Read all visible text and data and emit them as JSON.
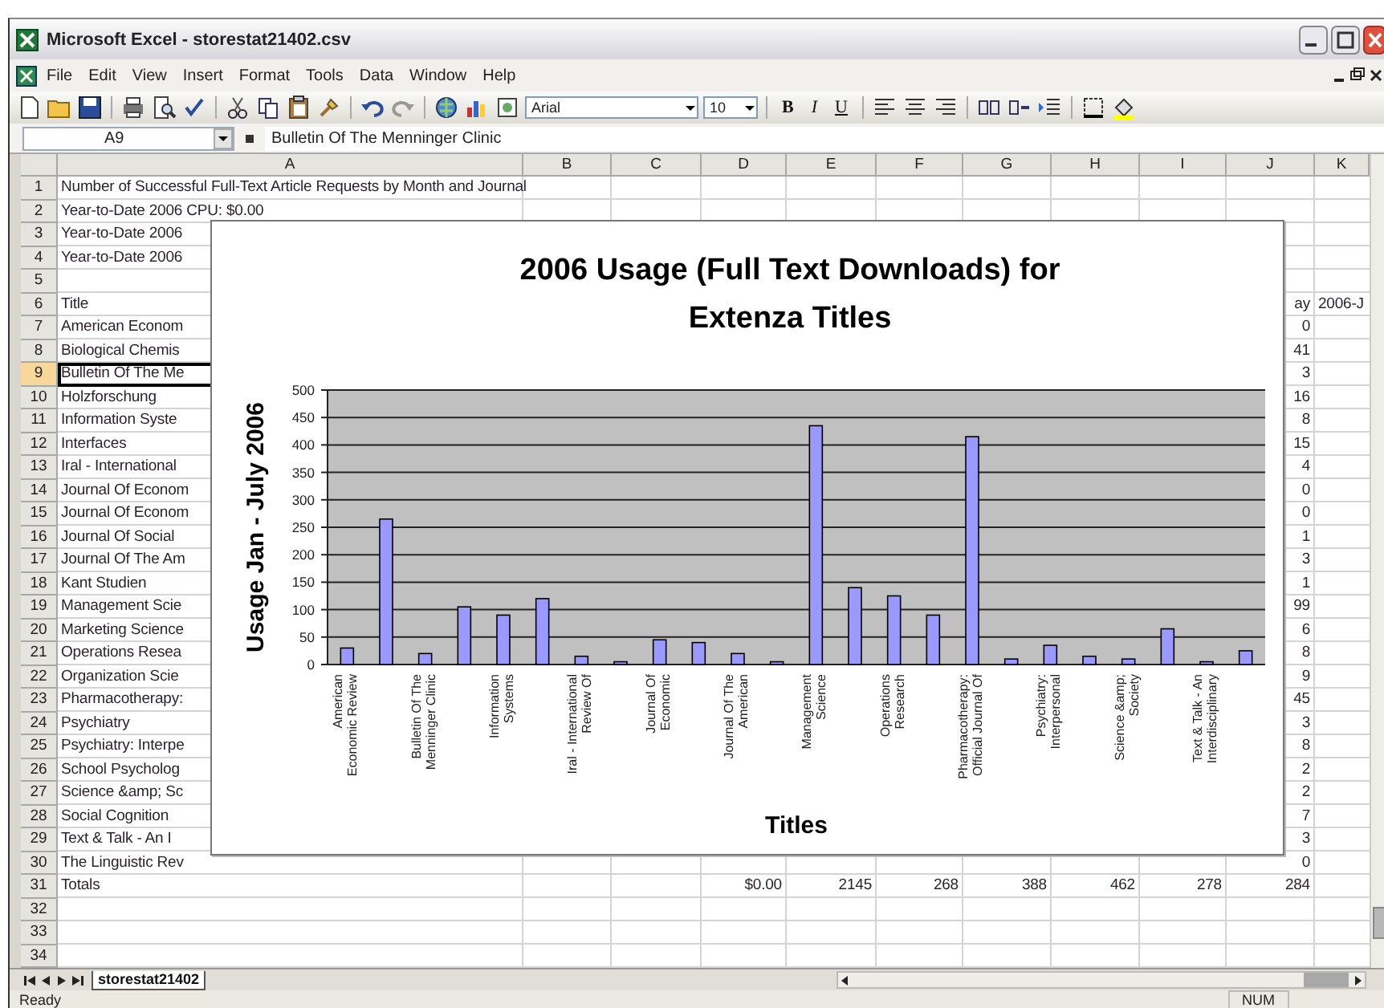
{
  "window": {
    "title": "Microsoft Excel - storestat21402.csv"
  },
  "menu": [
    "File",
    "Edit",
    "View",
    "Insert",
    "Format",
    "Tools",
    "Data",
    "Window",
    "Help"
  ],
  "toolbar": {
    "font": "Arial",
    "size": "10",
    "format_buttons": [
      "B",
      "I",
      "U"
    ]
  },
  "formula_bar": {
    "name_box": "A9",
    "content": "Bulletin Of The Menninger Clinic"
  },
  "columns": [
    "A",
    "B",
    "C",
    "D",
    "E",
    "F",
    "G",
    "H",
    "I",
    "J",
    "K"
  ],
  "rows": [
    {
      "number": "1",
      "selected": false,
      "cells": {
        "A": "Number of Successful Full-Text Article Requests by Month and Journal"
      }
    },
    {
      "number": "2",
      "selected": false,
      "cells": {
        "A": "Year-to-Date 2006 CPU: $0.00"
      }
    },
    {
      "number": "3",
      "selected": false,
      "cells": {
        "A": "Year-to-Date 2006"
      }
    },
    {
      "number": "4",
      "selected": false,
      "cells": {
        "A": "Year-to-Date 2006"
      }
    },
    {
      "number": "5",
      "selected": false
    },
    {
      "number": "6",
      "selected": false,
      "cells": {
        "A": "Title",
        "J": "ay",
        "K": "2006-J"
      }
    },
    {
      "number": "7",
      "selected": false,
      "cells": {
        "A": "American Econom",
        "J": "0"
      }
    },
    {
      "number": "8",
      "selected": false,
      "cells": {
        "A": "Biological Chemis",
        "J": "41"
      }
    },
    {
      "number": "9",
      "selected": true,
      "cells": {
        "A": "Bulletin Of The Me",
        "J": "3"
      }
    },
    {
      "number": "10",
      "selected": false,
      "cells": {
        "A": "Holzforschung",
        "J": "16"
      }
    },
    {
      "number": "11",
      "selected": false,
      "cells": {
        "A": "Information Syste",
        "J": "8"
      }
    },
    {
      "number": "12",
      "selected": false,
      "cells": {
        "A": "Interfaces",
        "J": "15"
      }
    },
    {
      "number": "13",
      "selected": false,
      "cells": {
        "A": "Iral - International",
        "J": "4"
      }
    },
    {
      "number": "14",
      "selected": false,
      "cells": {
        "A": "Journal Of Econom",
        "J": "0"
      }
    },
    {
      "number": "15",
      "selected": false,
      "cells": {
        "A": "Journal Of Econom",
        "J": "0"
      }
    },
    {
      "number": "16",
      "selected": false,
      "cells": {
        "A": "Journal Of Social",
        "J": "1"
      }
    },
    {
      "number": "17",
      "selected": false,
      "cells": {
        "A": "Journal Of The Am",
        "J": "3"
      }
    },
    {
      "number": "18",
      "selected": false,
      "cells": {
        "A": "Kant Studien",
        "J": "1"
      }
    },
    {
      "number": "19",
      "selected": false,
      "cells": {
        "A": "Management Scie",
        "J": "99"
      }
    },
    {
      "number": "20",
      "selected": false,
      "cells": {
        "A": "Marketing Science",
        "J": "6"
      }
    },
    {
      "number": "21",
      "selected": false,
      "cells": {
        "A": "Operations Resea",
        "J": "8"
      }
    },
    {
      "number": "22",
      "selected": false,
      "cells": {
        "A": "Organization Scie",
        "J": "9"
      }
    },
    {
      "number": "23",
      "selected": false,
      "cells": {
        "A": "Pharmacotherapy:",
        "J": "45"
      }
    },
    {
      "number": "24",
      "selected": false,
      "cells": {
        "A": "Psychiatry",
        "J": "3"
      }
    },
    {
      "number": "25",
      "selected": false,
      "cells": {
        "A": "Psychiatry: Interpe",
        "J": "8"
      }
    },
    {
      "number": "26",
      "selected": false,
      "cells": {
        "A": "School Psycholog",
        "J": "2"
      }
    },
    {
      "number": "27",
      "selected": false,
      "cells": {
        "A": "Science &amp; Sc",
        "J": "2"
      }
    },
    {
      "number": "28",
      "selected": false,
      "cells": {
        "A": "Social Cognition",
        "J": "7"
      }
    },
    {
      "number": "29",
      "selected": false,
      "cells": {
        "A": "Text & Talk - An I",
        "J": "3"
      }
    },
    {
      "number": "30",
      "selected": false,
      "cells": {
        "A": "The Linguistic Rev",
        "J": "0"
      }
    },
    {
      "number": "31",
      "selected": false,
      "cells": {
        "A": "Totals",
        "D": "$0.00",
        "E": "2145",
        "F": "268",
        "G": "388",
        "H": "462",
        "I": "278",
        "J": "284"
      }
    },
    {
      "number": "32",
      "selected": false
    },
    {
      "number": "33",
      "selected": false
    },
    {
      "number": "34",
      "selected": false
    }
  ],
  "chart": {
    "chart_data": {
      "type": "bar",
      "title": "2006 Usage (Full Text Downloads) for Extenza Titles",
      "xlabel": "Titles",
      "ylabel": "Usage Jan - July 2006",
      "categories": [
        "American\nEconomic Review",
        null,
        "Bulletin Of The\nMenninger Clinic",
        null,
        "Information\nSystems",
        null,
        "Iral - International\nReview Of",
        null,
        "Journal Of\nEconomic",
        null,
        "Journal Of The\nAmerican",
        null,
        "Management\nScience",
        null,
        "Operations\nResearch",
        null,
        "Pharmacotherapy:\nOfficial Journal Of",
        null,
        "Psychiatry:\nInterpersonal",
        null,
        "Science &amp;\nSociety",
        null,
        "Text & Talk - An\nInterdisciplinary",
        null
      ],
      "series": [
        {
          "color": "#9999ff",
          "values": [
            30,
            265,
            20,
            105,
            90,
            120,
            15,
            5,
            45,
            40,
            20,
            5,
            435,
            140,
            125,
            90,
            415,
            10,
            35,
            15,
            10,
            65,
            5,
            25
          ]
        }
      ],
      "ylim": [
        0,
        500
      ],
      "grid": true,
      "yticks": [
        {
          "value": 0,
          "label": "0"
        },
        {
          "value": 50,
          "label": "50"
        },
        {
          "value": 100,
          "label": "100"
        },
        {
          "value": 150,
          "label": "150"
        },
        {
          "value": 200,
          "label": "200"
        },
        {
          "value": 250,
          "label": "250"
        },
        {
          "value": 300,
          "label": "300"
        },
        {
          "value": 350,
          "label": "350"
        },
        {
          "value": 400,
          "label": "400"
        },
        {
          "value": 450,
          "label": "450"
        },
        {
          "value": 500,
          "label": "500"
        }
      ]
    }
  },
  "sheet_tabs": [
    {
      "label": "storestat21402",
      "selected": true
    }
  ],
  "status_bar": {
    "mode": "Ready",
    "indicator": "NUM"
  }
}
